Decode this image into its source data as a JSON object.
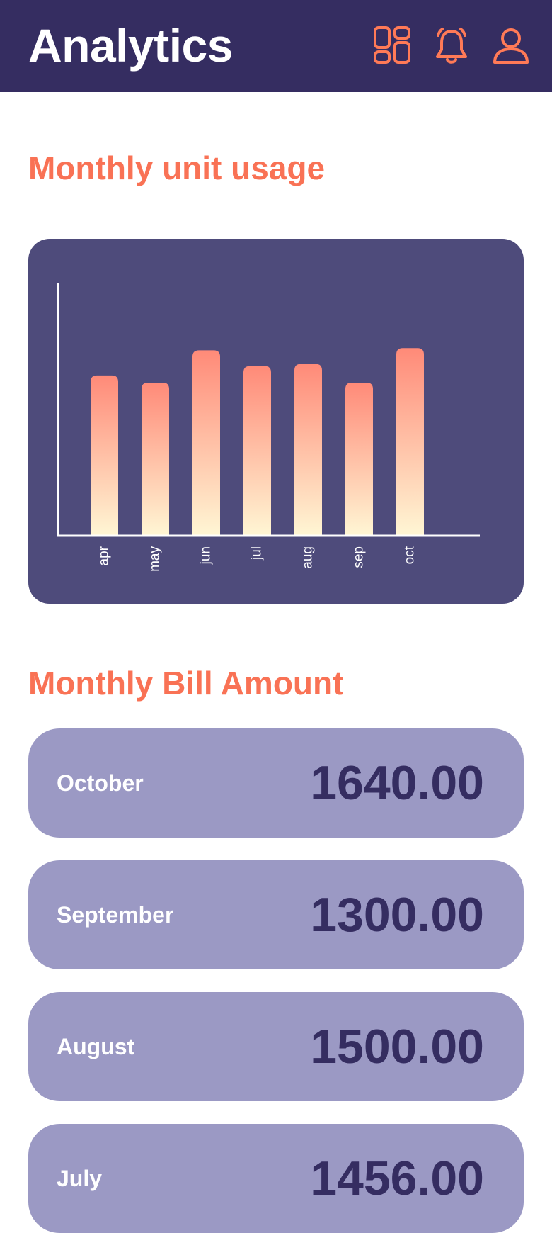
{
  "header": {
    "title": "Analytics",
    "icons": [
      "dashboard-grid-icon",
      "bell-icon",
      "user-profile-icon"
    ],
    "background": "#352d61",
    "icon_color": "#ff7a57"
  },
  "usage_section": {
    "title": "Monthly unit usage"
  },
  "chart_data": {
    "type": "bar",
    "categories": [
      "apr",
      "may",
      "jun",
      "jul",
      "aug",
      "sep",
      "oct"
    ],
    "values": [
      222,
      212,
      257,
      235,
      238,
      212,
      260
    ],
    "ylim": [
      0,
      350
    ],
    "xlabel": "",
    "ylabel": "",
    "grid": false,
    "legend": "none",
    "colors": {
      "card": "#4e4b7b",
      "bar_top": "#ff8a78",
      "bar_bottom": "#fff6d4",
      "axis": "#ffffff"
    }
  },
  "bill_section": {
    "title": "Monthly Bill Amount",
    "items": [
      {
        "month": "October",
        "amount": "1640.00"
      },
      {
        "month": "September",
        "amount": "1300.00"
      },
      {
        "month": "August",
        "amount": "1500.00"
      },
      {
        "month": "July",
        "amount": "1456.00"
      }
    ]
  },
  "colors": {
    "accent": "#f97255",
    "bill_card": "#9b99c4",
    "amount_text": "#352d61"
  }
}
